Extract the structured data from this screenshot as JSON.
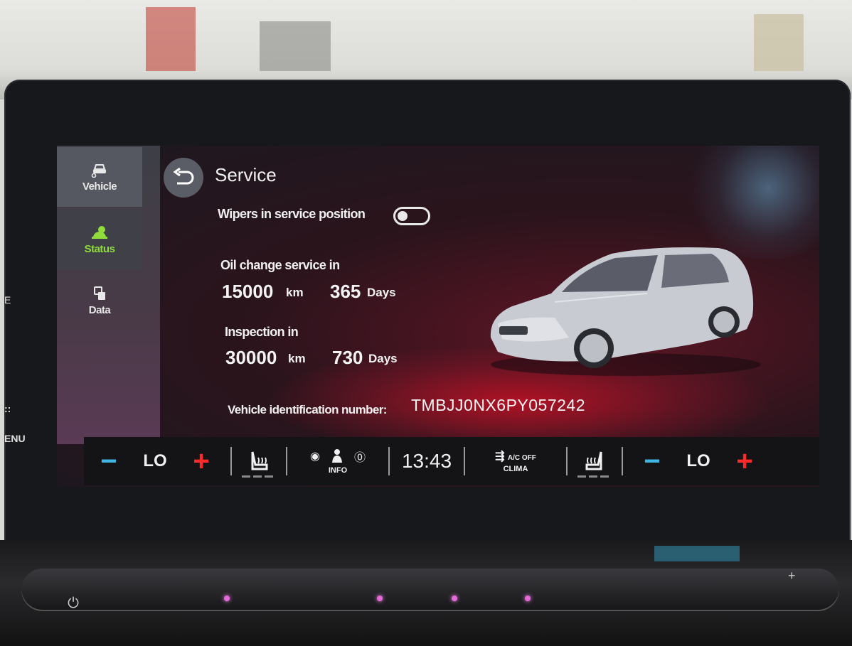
{
  "sidebar": {
    "items": [
      {
        "label": "Vehicle",
        "icon": "vehicle-icon"
      },
      {
        "label": "Status",
        "icon": "status-icon",
        "active": true
      },
      {
        "label": "Data",
        "icon": "data-icon"
      }
    ]
  },
  "header": {
    "title": "Service",
    "back_icon": "back-arrow-icon"
  },
  "wipers": {
    "label": "Wipers in service position",
    "enabled": false
  },
  "oil_change": {
    "label": "Oil change service in",
    "distance_value": "15000",
    "distance_unit": "km",
    "days_value": "365",
    "days_unit": "Days"
  },
  "inspection": {
    "label": "Inspection in",
    "distance_value": "30000",
    "distance_unit": "km",
    "days_value": "730",
    "days_unit": "Days"
  },
  "vin": {
    "label": "Vehicle identification number:",
    "value": "TMBJJ0NX6PY057242"
  },
  "climate_bar": {
    "left_minus": "−",
    "left_temp": "LO",
    "left_plus": "+",
    "info_label": "INFO",
    "clock": "13:43",
    "clima_label": "CLIMA",
    "ac_label": "A/C OFF",
    "right_minus": "−",
    "right_temp": "LO",
    "right_plus": "+"
  },
  "edge_text": {
    "menu_fragment": "ENU"
  },
  "colors": {
    "accent_green": "#8fdc3b",
    "minus_blue": "#3fb6e3",
    "plus_red": "#ff2a2a"
  }
}
